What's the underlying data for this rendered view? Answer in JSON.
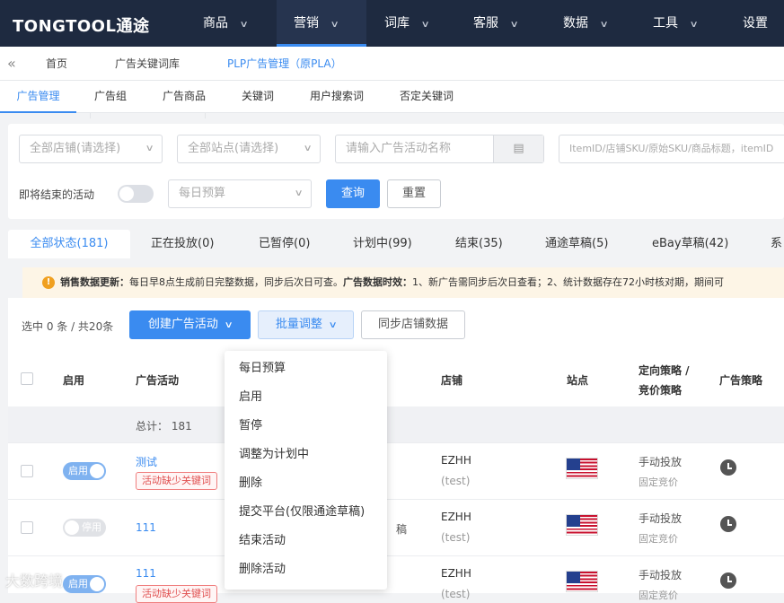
{
  "app": {
    "logo": "TONGTOOL通途",
    "nav": [
      {
        "label": "商品"
      },
      {
        "label": "营销"
      },
      {
        "label": "词库"
      },
      {
        "label": "客服"
      },
      {
        "label": "数据"
      },
      {
        "label": "工具"
      },
      {
        "label": "设置"
      }
    ]
  },
  "breadcrumb": {
    "collapse_icon": "«",
    "items": [
      "首页",
      "广告关键词库",
      "PLP广告管理（原PLA）"
    ]
  },
  "subtabs": [
    "广告管理",
    "广告组",
    "广告商品",
    "关键词",
    "用户搜索词",
    "否定关键词"
  ],
  "filters": {
    "store_select": "全部店铺(请选择)",
    "site_select": "全部站点(请选择)",
    "campaign_placeholder": "请输入广告活动名称",
    "item_placeholder": "ItemID/店铺SKU/原始SKU/商品标题，itemID",
    "ending_label": "即将结束的活动",
    "budget_select": "每日预算",
    "query_button": "查询",
    "reset_button": "重置"
  },
  "status_tabs": [
    "全部状态(181)",
    "正在投放(0)",
    "已暂停(0)",
    "计划中(99)",
    "结束(35)",
    "通途草稿(5)",
    "eBay草稿(42)",
    "系"
  ],
  "notice": {
    "icon": "!",
    "label1": "销售数据更新：",
    "text1": "每日早8点生成前日完整数据，同步后次日可查。",
    "label2": "广告数据时效：",
    "text2": "1、新广告需同步后次日查看；2、统计数据存在72小时核对期，期间可"
  },
  "actions": {
    "selection": "选中 0 条 / 共20条",
    "create_button": "创建广告活动",
    "batch_button": "批量调整",
    "sync_button": "同步店铺数据"
  },
  "table": {
    "headers": {
      "enable": "启用",
      "campaign": "广告活动",
      "store": "店铺",
      "site": "站点",
      "strategy_line1": "定向策略 /",
      "strategy_line2": "竞价策略",
      "ad_strategy": "广告策略"
    },
    "summary": "总计： 181",
    "rows": [
      {
        "switch": "启用",
        "campaign": "测试",
        "tag": "活动缺少关键词",
        "store": "EZHH",
        "store_sub": "(test)",
        "targeting": "手动投放",
        "bidding": "固定竞价"
      },
      {
        "switch": "停用",
        "campaign": "111",
        "extra": "稿",
        "store": "EZHH",
        "store_sub": "(test)",
        "targeting": "手动投放",
        "bidding": "固定竞价"
      },
      {
        "switch": "启用",
        "campaign": "111",
        "tag": "活动缺少关键词",
        "store": "EZHH",
        "store_sub": "(test)",
        "targeting": "手动投放",
        "bidding": "固定竞价"
      }
    ]
  },
  "batch_menu": [
    "每日预算",
    "启用",
    "暂停",
    "调整为计划中",
    "删除",
    "提交平台(仅限通途草稿)",
    "结束活动",
    "删除活动"
  ],
  "watermark": "大数跨境"
}
